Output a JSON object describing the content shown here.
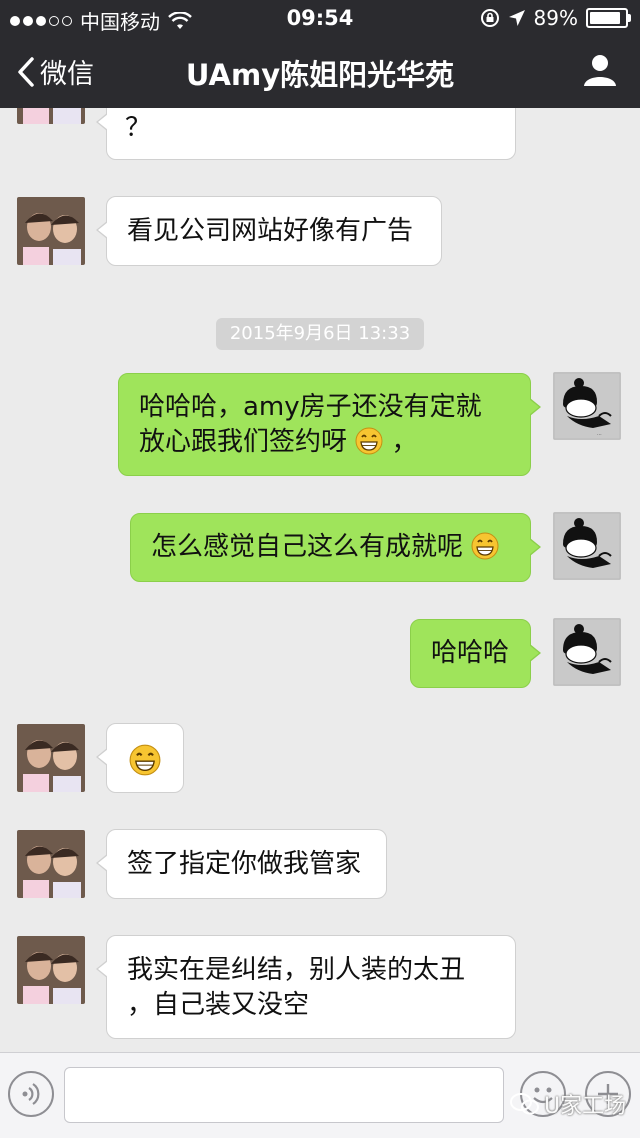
{
  "status_bar": {
    "carrier": "中国移动",
    "time": "09:54",
    "battery_percent": "89%",
    "battery_level": 0.89,
    "signal_bars_filled": 3,
    "signal_bars_total": 5
  },
  "nav": {
    "back_label": "微信",
    "title": "UAmy陈姐阳光华苑"
  },
  "timestamp": "2015年9月6日 13:33",
  "messages": [
    {
      "sender": "other",
      "text": "？"
    },
    {
      "sender": "other",
      "text": "看见公司网站好像有广告"
    },
    {
      "sender": "me",
      "text_line1": "哈哈哈，amy房子还没有定就",
      "text_line2": "放心跟我们签约呀",
      "text_after_emoji": "，",
      "emoji": "grin-emoji"
    },
    {
      "sender": "me",
      "text": "怎么感觉自己这么有成就呢",
      "emoji": "grin-emoji"
    },
    {
      "sender": "me",
      "text": "哈哈哈"
    },
    {
      "sender": "other",
      "emoji": "grin-emoji"
    },
    {
      "sender": "other",
      "text": "签了指定你做我管家"
    },
    {
      "sender": "other",
      "text_line1": "我实在是纠结，别人装的太丑",
      "text_line2": "，自己装又没空"
    }
  ],
  "watermark": "U家工场",
  "colors": {
    "bar_bg": "#2b2b2f",
    "chat_bg": "#ebebeb",
    "outgoing_bubble": "#9fe45b",
    "incoming_bubble": "#ffffff"
  }
}
